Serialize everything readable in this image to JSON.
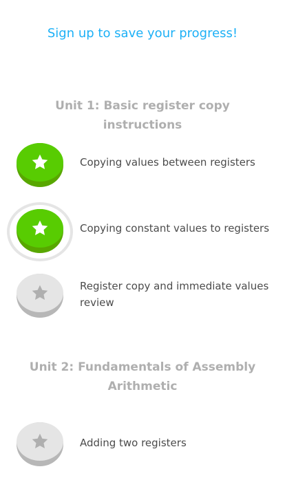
{
  "header": {
    "signup_text": "Sign up to save your progress!"
  },
  "units": [
    {
      "title": "Unit 1: Basic register copy instructions",
      "lessons": [
        {
          "label": "Copying values between registers",
          "status": "complete"
        },
        {
          "label": "Copying constant values to registers",
          "status": "complete-current"
        },
        {
          "label": "Register copy and immediate values review",
          "status": "locked"
        }
      ]
    },
    {
      "title": "Unit 2: Fundamentals of Assembly Arithmetic",
      "lessons": [
        {
          "label": "Adding two registers",
          "status": "locked"
        }
      ]
    }
  ],
  "colors": {
    "accent": "#1cb0f6",
    "complete_badge": "#58cc02",
    "locked_badge": "#e5e5e5",
    "unit_title": "#afafaf",
    "label_text": "#4b4b4b"
  },
  "icons": {
    "lesson_badge": "star-icon"
  }
}
